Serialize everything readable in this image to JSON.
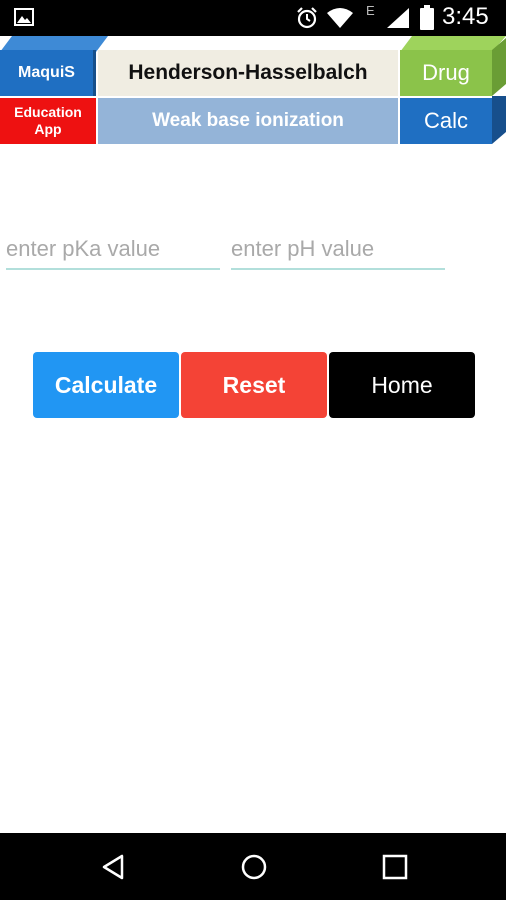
{
  "status_bar": {
    "time": "3:45",
    "network_label": "E",
    "icons": [
      "image-icon",
      "alarm-icon",
      "wifi-icon",
      "signal-icon",
      "battery-icon"
    ]
  },
  "banner": {
    "brand": "MaquiS",
    "education": "Education App",
    "title": "Henderson-Hasselbalch",
    "subtitle": "Weak base ionization",
    "drug_label": "Drug",
    "calc_label": "Calc",
    "colors": {
      "brand_blue": "#1f6fc2",
      "education_red": "#ee1111",
      "title_bg": "#f0ede2",
      "subtitle_bg": "#94b4d8",
      "drug_green": "#8bc34a"
    }
  },
  "form": {
    "pka": {
      "value": "",
      "placeholder": "enter pKa value"
    },
    "ph": {
      "value": "",
      "placeholder": "enter pH value"
    }
  },
  "buttons": {
    "calculate": "Calculate",
    "reset": "Reset",
    "home": "Home",
    "colors": {
      "calculate": "#2196f3",
      "reset": "#f44336",
      "home": "#000000"
    }
  },
  "nav": {
    "icons": [
      "back-icon",
      "home-circle-icon",
      "recents-icon"
    ]
  }
}
